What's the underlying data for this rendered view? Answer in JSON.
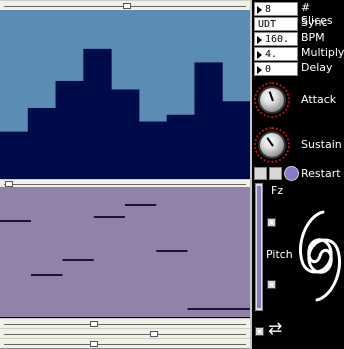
{
  "params": {
    "slices": {
      "value": "8",
      "label": "# Slices"
    },
    "sync": {
      "value": "UDT",
      "label": "Sync"
    },
    "bpm": {
      "value": "160.",
      "label": "BPM"
    },
    "multiply": {
      "value": "4.",
      "label": "Multiply"
    },
    "delay": {
      "value": "0",
      "label": "Delay"
    }
  },
  "knobs": {
    "attack": {
      "label": "Attack"
    },
    "sustain": {
      "label": "Sustain"
    }
  },
  "restart": {
    "label": "Restart"
  },
  "fz_label": "Fz",
  "pitch_label": "Pitch",
  "loop_icon_glyph": "⇄",
  "colors": {
    "slice_bg": "#5a8cb4",
    "slice_fg": "#000b4a",
    "pitch_bg": "#9382a8",
    "pitch_fg": "#221043",
    "radio_fill": "#8a78c8"
  },
  "slice_amplitudes": [
    0.28,
    0.42,
    0.58,
    0.77,
    0.53,
    0.34,
    0.38,
    0.69,
    0.46
  ],
  "pitch_segments": [
    {
      "start": 0.0,
      "end": 0.124,
      "level": 0.26
    },
    {
      "start": 0.124,
      "end": 0.25,
      "level": 0.68
    },
    {
      "start": 0.25,
      "end": 0.375,
      "level": 0.56
    },
    {
      "start": 0.375,
      "end": 0.5,
      "level": 0.23
    },
    {
      "start": 0.5,
      "end": 0.625,
      "level": 0.14
    },
    {
      "start": 0.625,
      "end": 0.75,
      "level": 0.49
    },
    {
      "start": 0.75,
      "end": 1.0,
      "level": 0.94
    }
  ],
  "sliders": {
    "top_scroll": 0.51,
    "mid_scroll": 0.02,
    "bottom_a": 0.37,
    "bottom_b": 0.62,
    "bottom_c": 0.37
  }
}
